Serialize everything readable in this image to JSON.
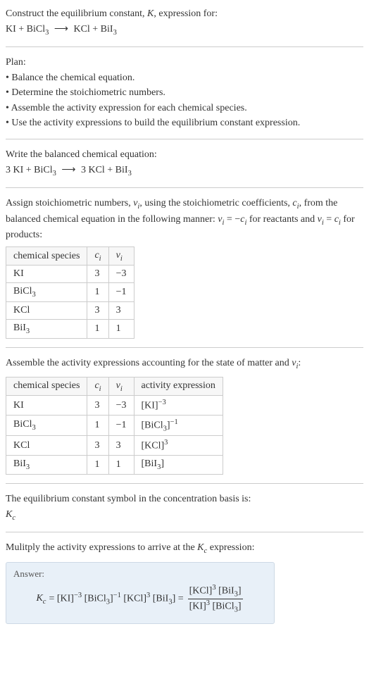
{
  "prompt": {
    "line1": "Construct the equilibrium constant, ",
    "K": "K",
    "line1b": ", expression for:",
    "eq_lhs1": "KI + BiCl",
    "eq_rhs1": "KCl + BiI"
  },
  "plan": {
    "title": "Plan:",
    "b1": "• Balance the chemical equation.",
    "b2": "• Determine the stoichiometric numbers.",
    "b3": "• Assemble the activity expression for each chemical species.",
    "b4": "• Use the activity expressions to build the equilibrium constant expression."
  },
  "balanced": {
    "title": "Write the balanced chemical equation:",
    "lhs": "3 KI + BiCl",
    "rhs": "3 KCl + BiI"
  },
  "stoich": {
    "intro1": "Assign stoichiometric numbers, ",
    "nu": "ν",
    "i": "i",
    "intro2": ", using the stoichiometric coefficients, ",
    "c": "c",
    "intro3": ", from the balanced chemical equation in the following manner: ",
    "rel1a": " = −",
    "rel1b": " for reactants and ",
    "rel2a": " = ",
    "rel2b": " for products:",
    "hdr1": "chemical species",
    "rows": [
      {
        "sp": "KI",
        "sub": "",
        "c": "3",
        "v": "−3"
      },
      {
        "sp": "BiCl",
        "sub": "3",
        "c": "1",
        "v": "−1"
      },
      {
        "sp": "KCl",
        "sub": "",
        "c": "3",
        "v": "3"
      },
      {
        "sp": "BiI",
        "sub": "3",
        "c": "1",
        "v": "1"
      }
    ]
  },
  "activity": {
    "intro": "Assemble the activity expressions accounting for the state of matter and ",
    "hdr4": "activity expression",
    "rows": [
      {
        "sp": "KI",
        "sub": "",
        "c": "3",
        "v": "−3",
        "base": "[KI]",
        "exp": "−3"
      },
      {
        "sp": "BiCl",
        "sub": "3",
        "c": "1",
        "v": "−1",
        "base": "[BiCl",
        "bclose": "]",
        "exp": "−1"
      },
      {
        "sp": "KCl",
        "sub": "",
        "c": "3",
        "v": "3",
        "base": "[KCl]",
        "exp": "3"
      },
      {
        "sp": "BiI",
        "sub": "3",
        "c": "1",
        "v": "1",
        "base": "[BiI",
        "bclose": "]",
        "exp": ""
      }
    ]
  },
  "kc": {
    "line1": "The equilibrium constant symbol in the concentration basis is:",
    "sym": "K",
    "subc": "c"
  },
  "mult": {
    "line": "Mulitply the activity expressions to arrive at the ",
    "end": " expression:"
  },
  "answer": {
    "label": "Answer:",
    "eq_pre": " = [KI]",
    "e1": "−3",
    "t2": " [BiCl",
    "e2": "−1",
    "t3": " [KCl]",
    "e3": "3",
    "t4": " [BiI",
    "t5": "] = ",
    "num1": "[KCl]",
    "num_e": "3",
    "num2": " [BiI",
    "num3": "]",
    "den1": "[KI]",
    "den_e": "3",
    "den2": " [BiCl",
    "den3": "]"
  },
  "sym": {
    "three": "3",
    "arrow": "⟶"
  }
}
